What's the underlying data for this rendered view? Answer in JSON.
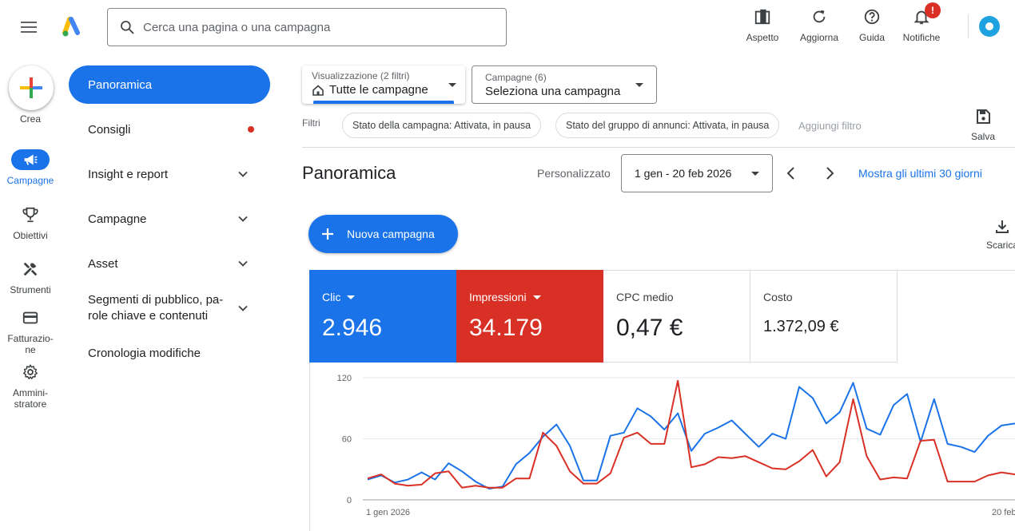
{
  "search": {
    "placeholder": "Cerca una pagina o una campagna"
  },
  "top_actions": [
    {
      "label": "Aspetto"
    },
    {
      "label": "Aggiorna"
    },
    {
      "label": "Guida"
    },
    {
      "label": "Notifiche",
      "badge": "!"
    }
  ],
  "rail": [
    {
      "label": "Crea"
    },
    {
      "label": "Campagne"
    },
    {
      "label": "Obiettivi"
    },
    {
      "label": "Strumenti"
    },
    {
      "label": "Fatturazio-\nne"
    },
    {
      "label": "Ammini-\nstratore"
    }
  ],
  "nav": [
    {
      "label": "Panoramica"
    },
    {
      "label": "Consigli"
    },
    {
      "label": "Insight e report"
    },
    {
      "label": "Campagne"
    },
    {
      "label": "Asset"
    },
    {
      "label": "Segmenti di pubblico, pa-\nrole chiave e contenuti"
    },
    {
      "label": "Cronologia modifiche"
    }
  ],
  "view_selector": {
    "small": "Visualizzazione (2 filtri)",
    "value": "Tutte le campagne"
  },
  "campaign_selector": {
    "small": "Campagne (6)",
    "value": "Seleziona una campagna"
  },
  "filters": {
    "label": "Filtri",
    "chips": [
      "Stato della campagna: Attivata, in pausa",
      "Stato del gruppo di annunci: Attivata, in pausa"
    ],
    "add": "Aggiungi filtro",
    "save": "Salva"
  },
  "header": {
    "title": "Panoramica",
    "range_type": "Personalizzato",
    "date_range": "1 gen - 20 feb 2026",
    "show_last": "Mostra gli ultimi 30 giorni"
  },
  "new_campaign": "Nuova campagna",
  "download": "Scarica",
  "metrics": [
    {
      "label": "Clic",
      "value": "2.946"
    },
    {
      "label": "Impressioni",
      "value": "34.179"
    },
    {
      "label": "CPC medio",
      "value": "0,47 €"
    },
    {
      "label": "Costo",
      "value": "1.372,09 €"
    }
  ],
  "colors": {
    "accent": "#1a73e8",
    "red": "#d93025"
  },
  "chart_data": {
    "type": "line",
    "y_ticks": [
      "120",
      "60",
      "0"
    ],
    "x_tick_labels": [
      "1 gen 2026",
      "20 feb"
    ],
    "ylim": [
      0,
      120
    ],
    "series": [
      {
        "color": "#1a73e8",
        "values": [
          20,
          24,
          17,
          20,
          27,
          20,
          36,
          28,
          18,
          11,
          13,
          35,
          46,
          62,
          74,
          53,
          19,
          19,
          63,
          66,
          90,
          82,
          69,
          85,
          48,
          65,
          71,
          78,
          65,
          52,
          65,
          60,
          111,
          100,
          75,
          86,
          115,
          70,
          64,
          93,
          104,
          57,
          99,
          55,
          52,
          47,
          63,
          73,
          75
        ]
      },
      {
        "color": "#d93025",
        "values": [
          21,
          25,
          16,
          14,
          15,
          26,
          28,
          12,
          14,
          12,
          12,
          21,
          21,
          66,
          53,
          28,
          16,
          16,
          26,
          61,
          66,
          55,
          55,
          117,
          32,
          35,
          42,
          41,
          43,
          37,
          31,
          30,
          38,
          49,
          23,
          37,
          99,
          43,
          20,
          22,
          21,
          58,
          59,
          18,
          18,
          18,
          24,
          27,
          25
        ]
      }
    ]
  }
}
